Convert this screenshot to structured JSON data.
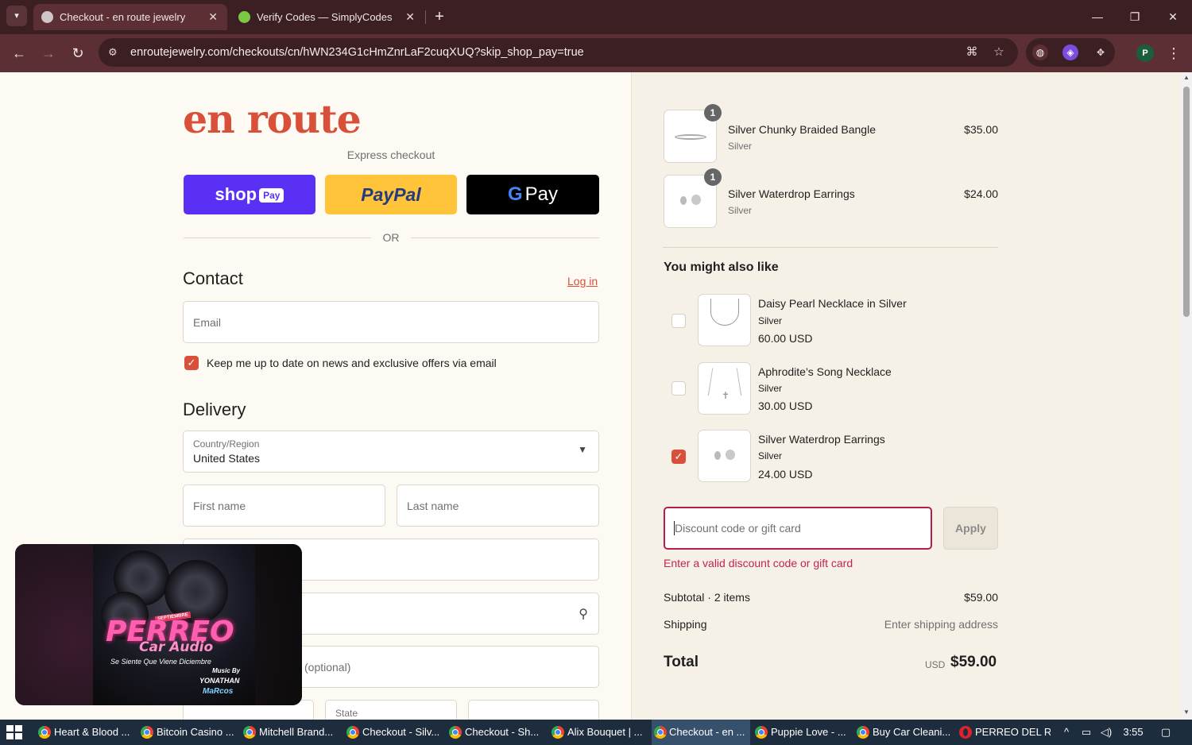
{
  "browser": {
    "tabs": [
      {
        "title": "Checkout - en route jewelry",
        "active": true
      },
      {
        "title": "Verify Codes — SimplyCodes",
        "active": false
      }
    ],
    "new_tab_symbol": "+",
    "url": "enroutejewelry.com/checkouts/cn/hWN234G1cHmZnrLaF2cuqXUQ?skip_shop_pay=true",
    "profile_initial": "P"
  },
  "checkout": {
    "logo": "en route",
    "express_label": "Express checkout",
    "shop_pay": {
      "shop": "shop",
      "pay": "Pay"
    },
    "paypal_label": "PayPal",
    "gpay": {
      "g": "G",
      "pay": "Pay"
    },
    "or_label": "OR",
    "contact": {
      "heading": "Contact",
      "login_link": "Log in",
      "email_placeholder": "Email",
      "newsletter_label": "Keep me up to date on news and exclusive offers via email",
      "newsletter_checked": true
    },
    "delivery": {
      "heading": "Delivery",
      "country_label": "Country/Region",
      "country_value": "United States",
      "first_name_placeholder": "First name",
      "last_name_placeholder": "Last name",
      "apartment_placeholder_suffix": "(optional)",
      "state_label": "State"
    }
  },
  "video_overlay": {
    "title": "PERREO",
    "subtitle": "Car Audio",
    "tagline": "Se Siente Que Viene Diciembre",
    "badge": "SEPTIEMBRE",
    "music_by": "Music By",
    "artist1": "YONATHAN",
    "artist2": "MaRcos"
  },
  "order_summary": {
    "items": [
      {
        "name": "Silver Chunky Braided Bangle",
        "variant": "Silver",
        "price": "$35.00",
        "qty": "1"
      },
      {
        "name": "Silver Waterdrop Earrings",
        "variant": "Silver",
        "price": "$24.00",
        "qty": "1"
      }
    ],
    "recommendations_heading": "You might also like",
    "recommendations": [
      {
        "name": "Daisy Pearl Necklace in Silver",
        "variant": "Silver",
        "price": "60.00 USD",
        "checked": false
      },
      {
        "name": "Aphrodite’s Song Necklace",
        "variant": "Silver",
        "price": "30.00 USD",
        "checked": false
      },
      {
        "name": "Silver Waterdrop Earrings",
        "variant": "Silver",
        "price": "24.00 USD",
        "checked": true
      }
    ],
    "discount_placeholder": "Discount code or gift card",
    "apply_label": "Apply",
    "discount_error": "Enter a valid discount code or gift card",
    "subtotal_label": "Subtotal · 2 items",
    "subtotal_value": "$59.00",
    "shipping_label": "Shipping",
    "shipping_value": "Enter shipping address",
    "total_label": "Total",
    "total_currency": "USD",
    "total_value": "$59.00",
    "accent_color": "#d9503a",
    "error_color": "#c0264f"
  },
  "taskbar": {
    "apps": [
      {
        "label": "Heart & Blood ..."
      },
      {
        "label": "Bitcoin Casino ..."
      },
      {
        "label": "Mitchell Brand..."
      },
      {
        "label": "Checkout - Silv..."
      },
      {
        "label": "Checkout - Sh..."
      },
      {
        "label": "Alix Bouquet | ..."
      },
      {
        "label": "Checkout - en ...",
        "current": true
      },
      {
        "label": "Puppie Love - ..."
      },
      {
        "label": "Buy Car Cleani..."
      },
      {
        "label": "PERREO DEL R..."
      }
    ],
    "time": "3:55"
  }
}
